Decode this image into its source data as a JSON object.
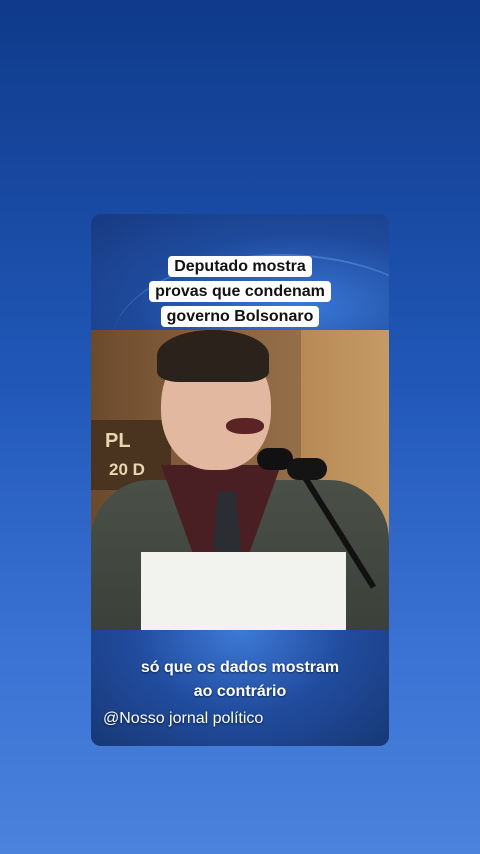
{
  "video": {
    "title_lines": [
      "Deputado mostra",
      "provas que condenam",
      "governo Bolsonaro"
    ],
    "subtitle_lines": [
      "só que os dados mostram",
      "ao contrário"
    ],
    "handle": "@Nosso jornal político",
    "plaque_line1": "PL",
    "plaque_line2": "20 D"
  }
}
